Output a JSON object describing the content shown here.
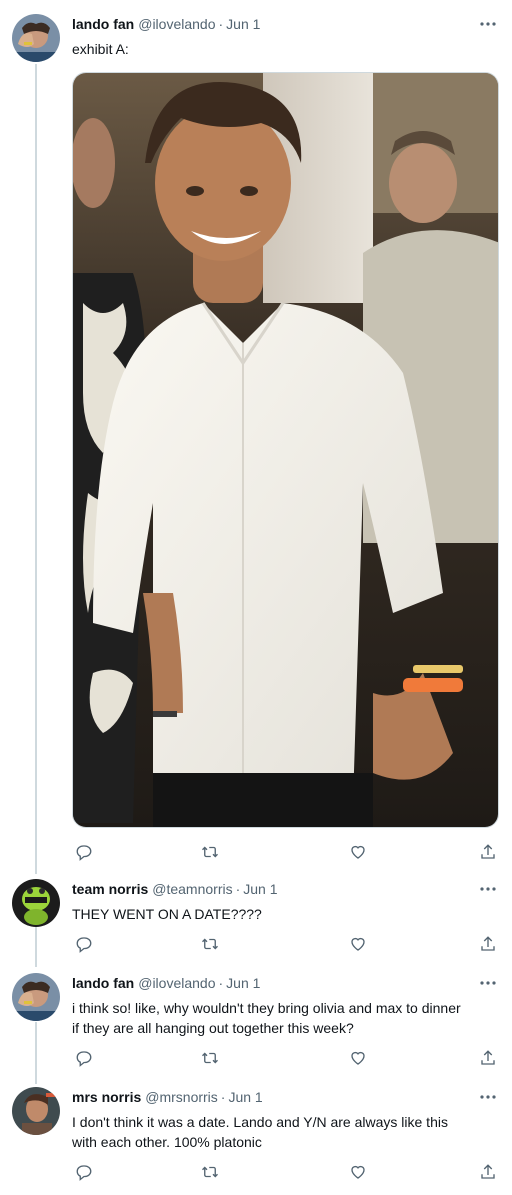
{
  "colors": {
    "text": "#0f1419",
    "muted": "#536471",
    "thread_line": "#cfd9de"
  },
  "tweets": [
    {
      "name": "lando fan",
      "handle": "@ilovelando",
      "separator": "·",
      "date": "Jun 1",
      "lines": [
        "exhibit A:"
      ],
      "has_media": true,
      "avatar_icon": "avatar-hand-photo",
      "actions": [
        "reply-icon",
        "retweet-icon",
        "like-icon",
        "share-icon"
      ]
    },
    {
      "name": "team norris",
      "handle": "@teamnorris",
      "separator": "·",
      "date": "Jun 1",
      "lines": [
        "THEY WENT ON A DATE????"
      ],
      "has_media": false,
      "avatar_icon": "avatar-green-helmet",
      "actions": [
        "reply-icon",
        "retweet-icon",
        "like-icon",
        "share-icon"
      ]
    },
    {
      "name": "lando fan",
      "handle": "@ilovelando",
      "separator": "·",
      "date": "Jun 1",
      "lines": [
        "i think so! like, why wouldn't they bring olivia and max to dinner",
        "if they are all hanging out together this week?"
      ],
      "has_media": false,
      "avatar_icon": "avatar-hand-photo",
      "actions": [
        "reply-icon",
        "retweet-icon",
        "like-icon",
        "share-icon"
      ]
    },
    {
      "name": "mrs norris",
      "handle": "@mrsnorris",
      "separator": "·",
      "date": "Jun 1",
      "lines": [
        "I don't think it was a date. Lando and Y/N are always like this",
        "with each other. 100% platonic"
      ],
      "has_media": false,
      "avatar_icon": "avatar-portrait-photo",
      "actions": [
        "reply-icon",
        "retweet-icon",
        "like-icon",
        "share-icon"
      ]
    }
  ]
}
